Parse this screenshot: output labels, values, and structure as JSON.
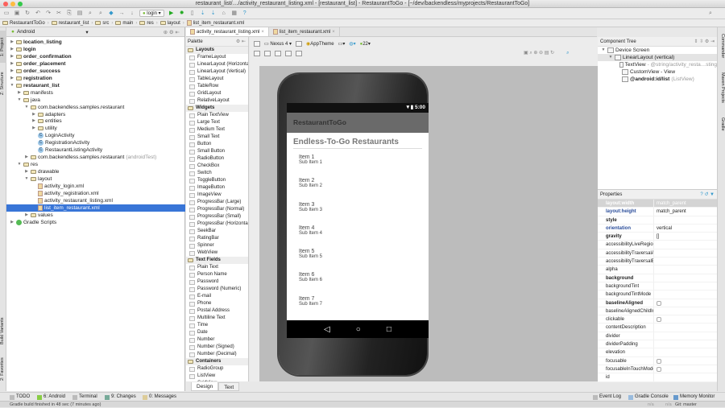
{
  "window": {
    "title": "restaurant_list/…/activity_restaurant_listing.xml - [restaurant_list] - RestaurantToGo - [~/dev/backendless/myprojects/RestaurantToGo]"
  },
  "toolbar": {
    "run_config": "login"
  },
  "breadcrumb": [
    "RestaurantToGo",
    "restaurant_list",
    "src",
    "main",
    "res",
    "layout",
    "list_item_restaurant.xml"
  ],
  "left_stripe": {
    "project": "1: Project",
    "structure": "Z: Structure",
    "build_variants": "Build Variants",
    "favorites": "2: Favorites"
  },
  "right_stripe": {
    "commander": "Commander",
    "maven": "Maven Projects",
    "gradle": "Gradle"
  },
  "project": {
    "view_mode": "Android",
    "tree": [
      {
        "label": "location_listing",
        "depth": 0,
        "bold": true,
        "arrow": "▶",
        "icon": "folder"
      },
      {
        "label": "login",
        "depth": 0,
        "bold": true,
        "arrow": "▶",
        "icon": "folder"
      },
      {
        "label": "order_confirmation",
        "depth": 0,
        "bold": true,
        "arrow": "▶",
        "icon": "folder"
      },
      {
        "label": "order_placement",
        "depth": 0,
        "bold": true,
        "arrow": "▶",
        "icon": "folder"
      },
      {
        "label": "order_success",
        "depth": 0,
        "bold": true,
        "arrow": "▶",
        "icon": "folder"
      },
      {
        "label": "registration",
        "depth": 0,
        "bold": true,
        "arrow": "▶",
        "icon": "folder"
      },
      {
        "label": "restaurant_list",
        "depth": 0,
        "bold": true,
        "arrow": "▼",
        "icon": "folder"
      },
      {
        "label": "manifests",
        "depth": 1,
        "arrow": "▶",
        "icon": "folder"
      },
      {
        "label": "java",
        "depth": 1,
        "arrow": "▼",
        "icon": "folder"
      },
      {
        "label": "com.backendless.samples.restaurant",
        "depth": 2,
        "arrow": "▼",
        "icon": "folder"
      },
      {
        "label": "adapters",
        "depth": 3,
        "arrow": "▶",
        "icon": "folder"
      },
      {
        "label": "entities",
        "depth": 3,
        "arrow": "▶",
        "icon": "folder"
      },
      {
        "label": "utility",
        "depth": 3,
        "arrow": "▶",
        "icon": "folder"
      },
      {
        "label": "LoginActivity",
        "depth": 3,
        "arrow": "",
        "icon": "class"
      },
      {
        "label": "RegistrationActivity",
        "depth": 3,
        "arrow": "",
        "icon": "class"
      },
      {
        "label": "RestaurantListingActivity",
        "depth": 3,
        "arrow": "",
        "icon": "class"
      },
      {
        "label": "com.backendless.samples.restaurant",
        "suffix": "(androidTest)",
        "depth": 2,
        "arrow": "▶",
        "icon": "folder"
      },
      {
        "label": "res",
        "depth": 1,
        "arrow": "▼",
        "icon": "folder"
      },
      {
        "label": "drawable",
        "depth": 2,
        "arrow": "▶",
        "icon": "folder"
      },
      {
        "label": "layout",
        "depth": 2,
        "arrow": "▼",
        "icon": "folder"
      },
      {
        "label": "activity_login.xml",
        "depth": 3,
        "arrow": "",
        "icon": "file"
      },
      {
        "label": "activity_registration.xml",
        "depth": 3,
        "arrow": "",
        "icon": "file"
      },
      {
        "label": "activity_restaurant_listing.xml",
        "depth": 3,
        "arrow": "",
        "icon": "file"
      },
      {
        "label": "list_item_restaurant.xml",
        "depth": 3,
        "arrow": "",
        "icon": "file",
        "selected": true
      },
      {
        "label": "values",
        "depth": 2,
        "arrow": "▶",
        "icon": "folder"
      },
      {
        "label": "Gradle Scripts",
        "depth": 0,
        "arrow": "▶",
        "icon": "gradle"
      }
    ]
  },
  "editor_tabs": [
    {
      "label": "activity_restaurant_listing.xml",
      "active": true
    },
    {
      "label": "list_item_restaurant.xml",
      "active": false
    }
  ],
  "palette": {
    "title": "Palette",
    "sections": [
      {
        "title": "Layouts",
        "items": [
          "FrameLayout",
          "LinearLayout (Horizontal)",
          "LinearLayout (Vertical)",
          "TableLayout",
          "TableRow",
          "GridLayout",
          "RelativeLayout"
        ]
      },
      {
        "title": "Widgets",
        "items": [
          "Plain TextView",
          "Large Text",
          "Medium Text",
          "Small Text",
          "Button",
          "Small Button",
          "RadioButton",
          "CheckBox",
          "Switch",
          "ToggleButton",
          "ImageButton",
          "ImageView",
          "ProgressBar (Large)",
          "ProgressBar (Normal)",
          "ProgressBar (Small)",
          "ProgressBar (Horizontal)",
          "SeekBar",
          "RatingBar",
          "Spinner",
          "WebView"
        ]
      },
      {
        "title": "Text Fields",
        "items": [
          "Plain Text",
          "Person Name",
          "Password",
          "Password (Numeric)",
          "E-mail",
          "Phone",
          "Postal Address",
          "Multiline Text",
          "Time",
          "Date",
          "Number",
          "Number (Signed)",
          "Number (Decimal)"
        ]
      },
      {
        "title": "Containers",
        "items": [
          "RadioGroup",
          "ListView",
          "GridView"
        ]
      }
    ]
  },
  "editor_toolbar": {
    "device": "Nexus 4",
    "theme": "AppTheme",
    "api": "22"
  },
  "device": {
    "time": "5:00",
    "app_title": "RestaurantToGo",
    "list_title": "Endless-To-Go Restaurants",
    "items": [
      {
        "title": "Item 1",
        "sub": "Sub Item 1"
      },
      {
        "title": "Item 2",
        "sub": "Sub Item 2"
      },
      {
        "title": "Item 3",
        "sub": "Sub Item 3"
      },
      {
        "title": "Item 4",
        "sub": "Sub Item 4"
      },
      {
        "title": "Item 5",
        "sub": "Sub Item 5"
      },
      {
        "title": "Item 6",
        "sub": "Sub Item 6"
      },
      {
        "title": "Item 7",
        "sub": "Sub Item 7"
      }
    ]
  },
  "design_tabs": {
    "design": "Design",
    "text": "Text"
  },
  "component_tree": {
    "title": "Component Tree",
    "nodes": [
      {
        "label": "Device Screen",
        "depth": 0
      },
      {
        "label": "LinearLayout (vertical)",
        "depth": 1,
        "selected": true
      },
      {
        "label": "TextView",
        "suffix": "- @string/activity_resta…sting",
        "depth": 2
      },
      {
        "label": "CustomView - View",
        "depth": 2
      },
      {
        "label": "@android:id/list",
        "suffix": "(ListView)",
        "depth": 2
      }
    ]
  },
  "properties": {
    "title": "Properties",
    "rows": [
      {
        "k": "layout:width",
        "v": "match_parent",
        "style": "sel"
      },
      {
        "k": "layout:height",
        "v": "match_parent",
        "style": "blue"
      },
      {
        "k": "style",
        "v": "",
        "style": "bold"
      },
      {
        "k": "orientation",
        "v": "vertical",
        "style": "blue"
      },
      {
        "k": "gravity",
        "v": "[]",
        "style": "bold"
      },
      {
        "k": "accessibilityLiveRegion",
        "v": ""
      },
      {
        "k": "accessibilityTraversalAfter",
        "v": ""
      },
      {
        "k": "accessibilityTraversalBefore",
        "v": ""
      },
      {
        "k": "alpha",
        "v": ""
      },
      {
        "k": "background",
        "v": "",
        "style": "bold"
      },
      {
        "k": "backgroundTint",
        "v": ""
      },
      {
        "k": "backgroundTintMode",
        "v": ""
      },
      {
        "k": "baselineAligned",
        "v": "",
        "style": "bold",
        "checkbox": true
      },
      {
        "k": "baselineAlignedChildIndex",
        "v": ""
      },
      {
        "k": "clickable",
        "v": "",
        "checkbox": true
      },
      {
        "k": "contentDescription",
        "v": ""
      },
      {
        "k": "divider",
        "v": ""
      },
      {
        "k": "dividerPadding",
        "v": ""
      },
      {
        "k": "elevation",
        "v": ""
      },
      {
        "k": "focusable",
        "v": "",
        "checkbox": true
      },
      {
        "k": "focusableInTouchMode",
        "v": "",
        "checkbox": true
      },
      {
        "k": "id",
        "v": ""
      }
    ]
  },
  "bottom_tools": {
    "todo": "TODO",
    "android": "6: Android",
    "terminal": "Terminal",
    "changes": "9: Changes",
    "messages": "0: Messages",
    "event_log": "Event Log",
    "gradle_console": "Gradle Console",
    "memory_monitor": "Memory Monitor"
  },
  "status": {
    "message": "Gradle build finished in 48 sec (7 minutes ago)",
    "na1": "n/a",
    "na2": "n/a",
    "git": "Git: master"
  }
}
